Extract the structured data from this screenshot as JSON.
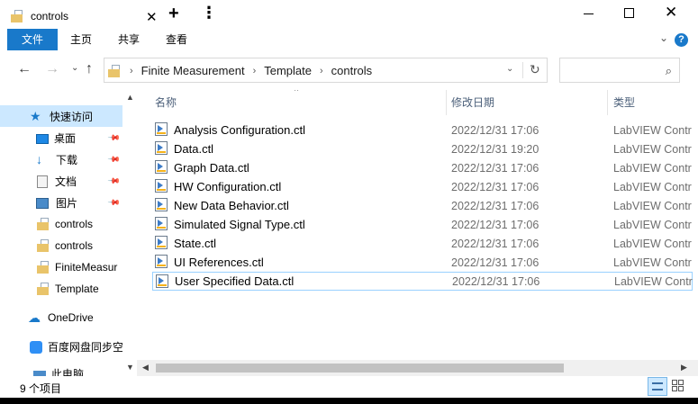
{
  "window": {
    "tab_title": "controls",
    "tab_close": "✕",
    "new_tab": "+",
    "more": "⋮",
    "minimize": "—",
    "maximize": "☐",
    "close": "✕"
  },
  "ribbon": {
    "tabs": [
      {
        "label": "文件"
      },
      {
        "label": "主页"
      },
      {
        "label": "共享"
      },
      {
        "label": "查看"
      }
    ],
    "expand": "⌄",
    "help": "?"
  },
  "address": {
    "back": "←",
    "forward": "→",
    "recent": "⌄",
    "up": "↑",
    "breadcrumbs": [
      "Finite Measurement",
      "Template",
      "controls"
    ],
    "separator": "›",
    "recent_locations": "⌄",
    "refresh": "↻"
  },
  "search": {
    "placeholder": "",
    "icon": "⌕"
  },
  "nav": {
    "items": [
      {
        "label": "快速访问",
        "icon": "star-icon",
        "pinned": false
      },
      {
        "label": "桌面",
        "icon": "desktop-icon",
        "pinned": true
      },
      {
        "label": "下载",
        "icon": "download-icon",
        "pinned": true
      },
      {
        "label": "文档",
        "icon": "documents-icon",
        "pinned": true
      },
      {
        "label": "图片",
        "icon": "pictures-icon",
        "pinned": true
      },
      {
        "label": "controls",
        "icon": "folder-icon",
        "pinned": false
      },
      {
        "label": "controls",
        "icon": "folder-icon",
        "pinned": false
      },
      {
        "label": "FiniteMeasur",
        "icon": "folder-icon",
        "pinned": false
      },
      {
        "label": "Template",
        "icon": "folder-icon",
        "pinned": false
      },
      {
        "label": "OneDrive",
        "icon": "onedrive-icon",
        "pinned": false
      },
      {
        "label": "百度网盘同步空",
        "icon": "baidu-icon",
        "pinned": false
      },
      {
        "label": "此电脑",
        "icon": "pc-icon",
        "pinned": false
      }
    ],
    "pin_glyph": "📌"
  },
  "columns": {
    "name": "名称",
    "date": "修改日期",
    "type": "类型"
  },
  "files": [
    {
      "name": "Analysis Configuration.ctl",
      "date": "2022/12/31 17:06",
      "type": "LabVIEW Contr"
    },
    {
      "name": "Data.ctl",
      "date": "2022/12/31 19:20",
      "type": "LabVIEW Contr"
    },
    {
      "name": "Graph Data.ctl",
      "date": "2022/12/31 17:06",
      "type": "LabVIEW Contr"
    },
    {
      "name": "HW Configuration.ctl",
      "date": "2022/12/31 17:06",
      "type": "LabVIEW Contr"
    },
    {
      "name": "New Data Behavior.ctl",
      "date": "2022/12/31 17:06",
      "type": "LabVIEW Contr"
    },
    {
      "name": "Simulated Signal Type.ctl",
      "date": "2022/12/31 17:06",
      "type": "LabVIEW Contr"
    },
    {
      "name": "State.ctl",
      "date": "2022/12/31 17:06",
      "type": "LabVIEW Contr"
    },
    {
      "name": "UI References.ctl",
      "date": "2022/12/31 17:06",
      "type": "LabVIEW Contr"
    },
    {
      "name": "User Specified Data.ctl",
      "date": "2022/12/31 17:06",
      "type": "LabVIEW Contr"
    }
  ],
  "status": {
    "item_count": "9 个项目"
  },
  "colors": {
    "accent": "#1979ca",
    "selection": "#cce8ff"
  }
}
